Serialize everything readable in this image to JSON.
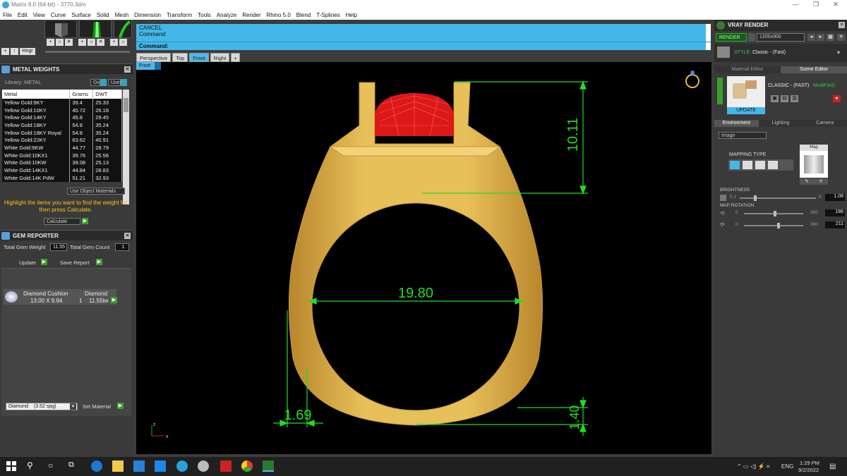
{
  "app": {
    "title": "Matrix 8.0 (64-bit) - 3770.3dm"
  },
  "window_controls": {
    "minimize": "—",
    "maximize": "❐",
    "close": "✕"
  },
  "menu": [
    "File",
    "Edit",
    "View",
    "Curve",
    "Surface",
    "Solid",
    "Mesh",
    "Dimension",
    "Transform",
    "Tools",
    "Analyze",
    "Render",
    "Rhino 5.0",
    "Blend",
    "T-Splines",
    "Help"
  ],
  "toolbar_left": {
    "hinge_label": "Hngr"
  },
  "metal_weights": {
    "title": "METAL WEIGHTS",
    "library_label": "Library: METAL",
    "btn_ov": "Ov",
    "btn_user": "User",
    "columns": [
      "Metal",
      "Grams",
      "DWT"
    ],
    "rows": [
      [
        "Yellow Gold:9KY",
        "39.4",
        "25.33"
      ],
      [
        "Yellow Gold:10KY",
        "40.72",
        "26.18"
      ],
      [
        "Yellow Gold:14KY",
        "45.8",
        "29.45"
      ],
      [
        "Yellow Gold:18KY",
        "54.8",
        "35.24"
      ],
      [
        "Yellow Gold:18KY Royal",
        "54.8",
        "35.24"
      ],
      [
        "Yellow Gold:22KY",
        "63.62",
        "40.91"
      ],
      [
        "White Gold:9KW",
        "44.77",
        "28.79"
      ],
      [
        "White Gold:10KX1",
        "39.76",
        "25.56"
      ],
      [
        "White Gold:10KW",
        "39.08",
        "25.13"
      ],
      [
        "White Gold:14KX1",
        "44.84",
        "28.83"
      ],
      [
        "White Gold:14K PdW",
        "51.21",
        "32.93"
      ]
    ],
    "use_object_materials": "Use Object Materials",
    "hint": "Highlight the items you want to find the weight for then press Calculate.",
    "calculate": "Calculate"
  },
  "gem_reporter": {
    "title": "GEM REPORTER",
    "total_weight_label": "Total Gem Weight",
    "total_weight_value": "11.55",
    "total_count_label": "Total Gem Count",
    "total_count_value": "1",
    "update": "Update",
    "save_report": "Save Report",
    "gem": {
      "shape": "Diamond Cushion",
      "size": "13.00 X 9.94",
      "material": "Diamond",
      "count": "1",
      "weight": "11.55tw"
    },
    "material_select": "Diamond",
    "material_sg": "(3.52 spg)",
    "set_material": "Set Material"
  },
  "command": {
    "line1": "CANCEL",
    "line2": "Command:",
    "prompt": "Command:"
  },
  "viewport_tabs": [
    "Perspective",
    "Top",
    "Front",
    "Right"
  ],
  "active_tab": "Front",
  "viewport_label": "Front",
  "dimensions": {
    "height": "10.11",
    "inner_diameter": "19.80",
    "shank_width": "1.69",
    "shank_thickness": "1.40"
  },
  "axes": {
    "z": "z",
    "x": "x"
  },
  "vray": {
    "title": "VRAY RENDER",
    "render_btn": "RENDER",
    "resolution": "1200x900",
    "style_label": "STYLE:",
    "style_value": "Classic - (Fast)",
    "tabs": [
      "Material Editor",
      "Scene Editor"
    ],
    "scene_name": "CLASSIC - (FAST)",
    "scene_mod": "ModiFast)",
    "update": "UPDATE",
    "subtabs": [
      "Environment",
      "Lighting",
      "Camera"
    ],
    "env_select": "Image",
    "mapping_type": "MAPPING TYPE",
    "map_label": "Map",
    "brightness_label": "BRIGHTNESS",
    "brightness_min": "0.1",
    "brightness_max": "5",
    "brightness_value": "1.08",
    "map_rotation_label": "MAP ROTATION",
    "rot1_min": "0",
    "rot1_max": "360",
    "rot1_value": "186",
    "rot2_min": "0",
    "rot2_max": "360",
    "rot2_value": "211"
  },
  "taskbar": {
    "lang": "ENG",
    "time": "1:29 PM",
    "date": "9/2/2022"
  },
  "colors": {
    "gold": "#e3b84d",
    "dim_green": "#22dd22",
    "cmd_blue": "#43b7e8",
    "gem_red": "#e01818"
  }
}
